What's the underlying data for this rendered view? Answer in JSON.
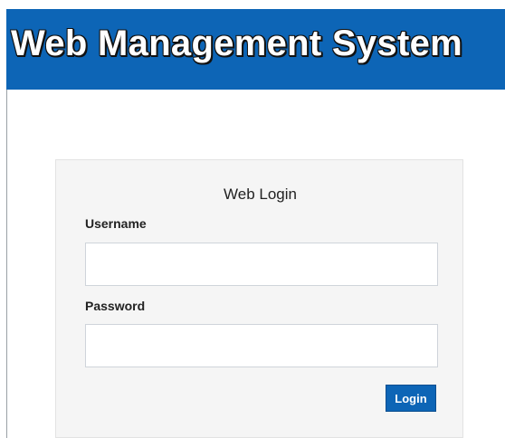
{
  "header": {
    "title": "Web Management System"
  },
  "login": {
    "title": "Web Login",
    "username_label": "Username",
    "username_value": "",
    "username_placeholder": "",
    "password_label": "Password",
    "password_value": "",
    "password_placeholder": "",
    "submit_label": "Login"
  },
  "colors": {
    "header_bg": "#0d65b6",
    "panel_bg": "#f5f5f5",
    "button_bg": "#0d65b6"
  }
}
